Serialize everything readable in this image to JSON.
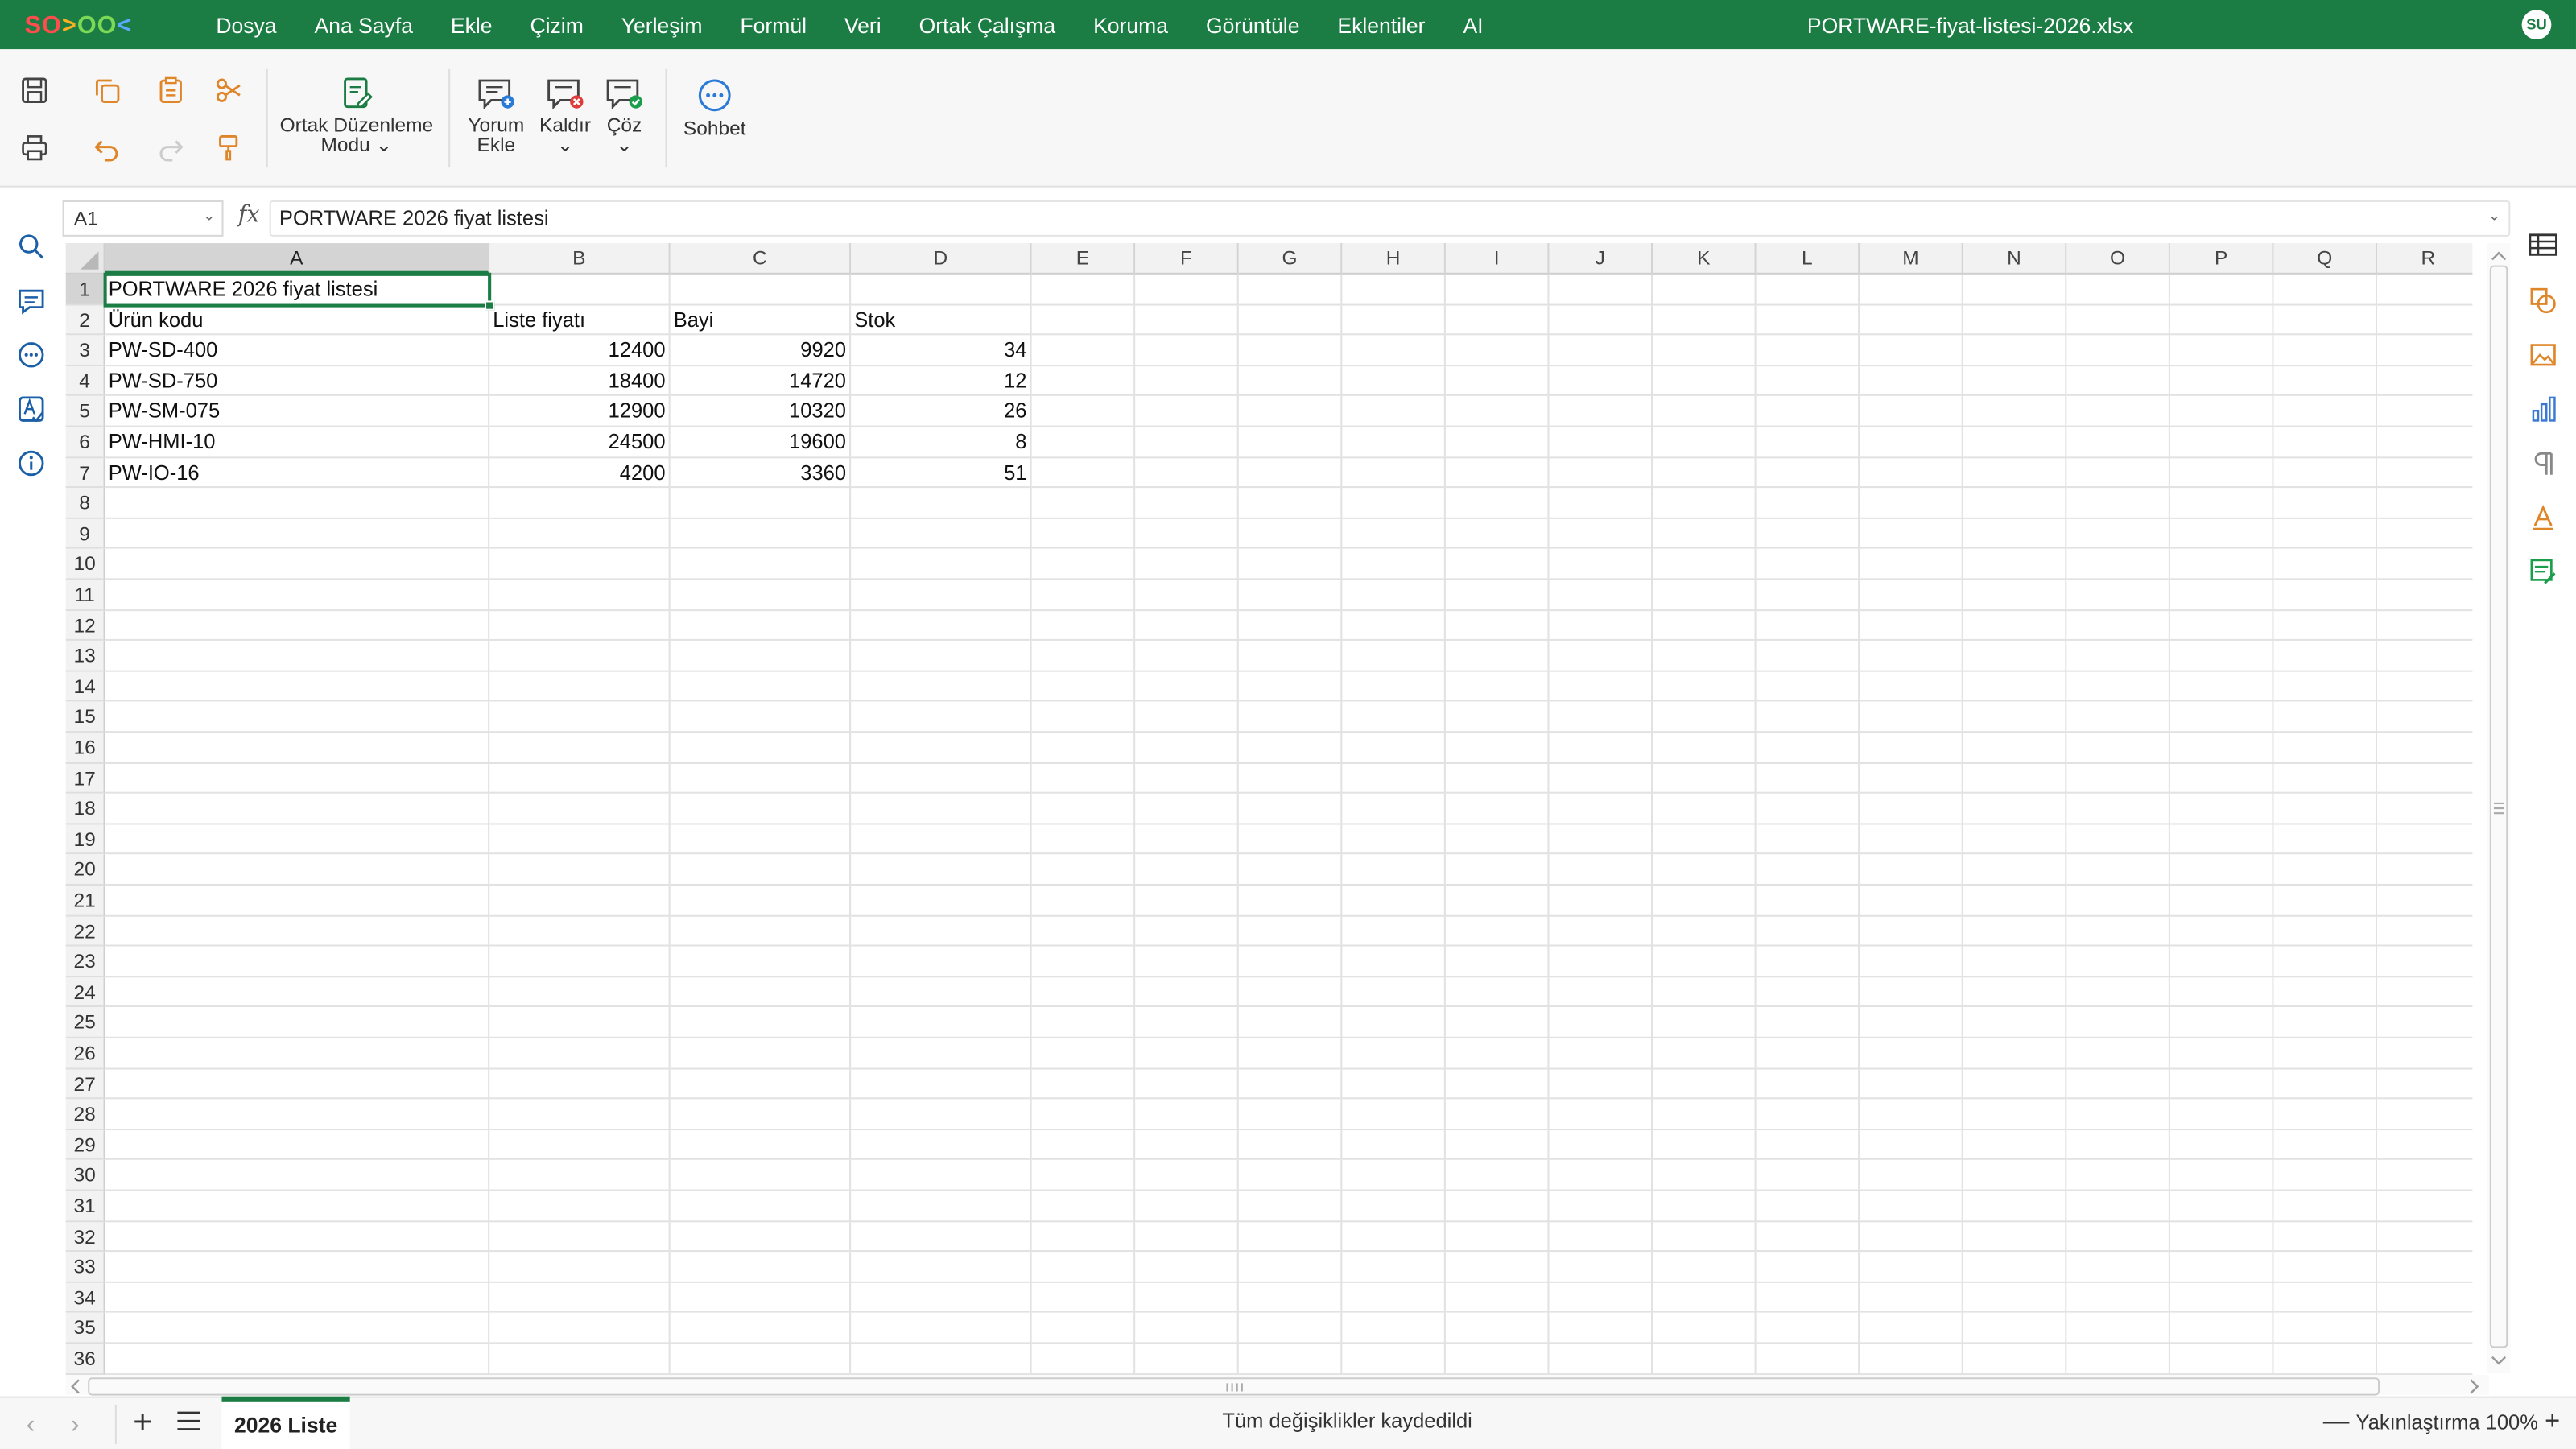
{
  "app": {
    "logo_letters": [
      "SO",
      ">",
      "OO",
      "<"
    ],
    "colors": {
      "brand": "#1b7d43",
      "logo_red": "#ff4d4d",
      "logo_orange": "#ffb020",
      "logo_green": "#7cd956",
      "logo_blue": "#5aa9ff"
    }
  },
  "menu": [
    "Dosya",
    "Ana Sayfa",
    "Ekle",
    "Çizim",
    "Yerleşim",
    "Formül",
    "Veri",
    "Ortak Çalışma",
    "Koruma",
    "Görüntüle",
    "Eklentiler",
    "AI"
  ],
  "document_title": "PORTWARE-fiyat-listesi-2026.xlsx",
  "user_initials": "SU",
  "ribbon": {
    "coedit_label_1": "Ortak Düzenleme",
    "coedit_label_2": "Modu",
    "add_comment_1": "Yorum",
    "add_comment_2": "Ekle",
    "remove": "Kaldır",
    "resolve": "Çöz",
    "chat": "Sohbet"
  },
  "formula_bar": {
    "name_box": "A1",
    "fx": "fx",
    "content": "PORTWARE 2026 fiyat listesi"
  },
  "grid": {
    "columns": [
      "A",
      "B",
      "C",
      "D",
      "E",
      "F",
      "G",
      "H",
      "I",
      "J",
      "K",
      "L",
      "M",
      "N",
      "O",
      "P",
      "Q",
      "R"
    ],
    "row_count": 36,
    "selected_cell": "A1",
    "rows": [
      [
        "PORTWARE 2026 fiyat listesi",
        "",
        "",
        ""
      ],
      [
        "Ürün kodu",
        "Liste fiyatı",
        "Bayi",
        "Stok"
      ],
      [
        "PW-SD-400",
        "12400",
        "9920",
        "34"
      ],
      [
        "PW-SD-750",
        "18400",
        "14720",
        "12"
      ],
      [
        "PW-SM-075",
        "12900",
        "10320",
        "26"
      ],
      [
        "PW-HMI-10",
        "24500",
        "19600",
        "8"
      ],
      [
        "PW-IO-16",
        "4200",
        "3360",
        "51"
      ]
    ]
  },
  "sheet_tab": "2026 Liste",
  "status": "Tüm değişiklikler kaydedildi",
  "zoom": {
    "label": "Yakınlaştırma 100%"
  }
}
